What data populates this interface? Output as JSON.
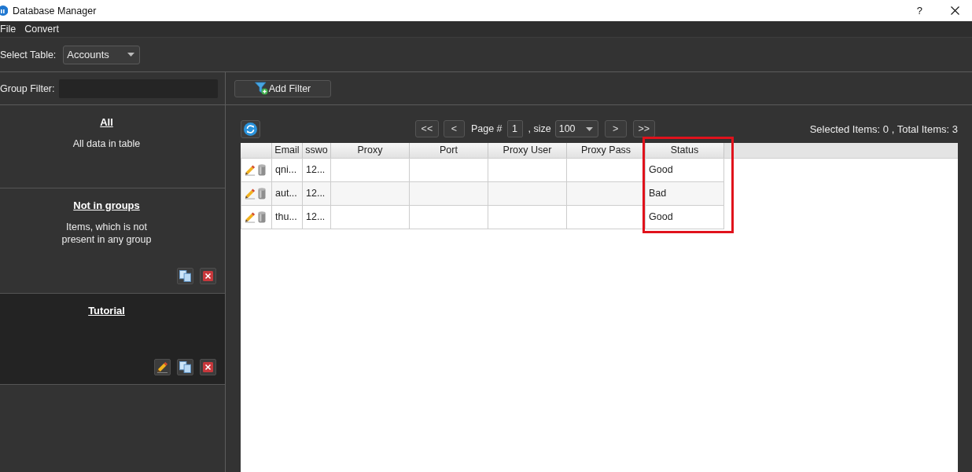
{
  "window": {
    "title": "Database Manager",
    "help": "?"
  },
  "menu": [
    {
      "label": "File"
    },
    {
      "label": "Convert"
    }
  ],
  "toolbar": {
    "label": "Select Table:",
    "table_select": {
      "value": "Accounts"
    }
  },
  "sidebar": {
    "filter": {
      "label": "Group Filter:"
    },
    "groups": [
      {
        "title": "All",
        "description": "All data in table",
        "selected": false
      },
      {
        "title": "Not in groups",
        "description": "Items, which is not present in any group",
        "selected": false,
        "actions": [
          {
            "kind": "copy"
          },
          {
            "kind": "delete"
          }
        ]
      },
      {
        "title": "Tutorial",
        "selected": true,
        "actions": [
          {
            "kind": "edit"
          },
          {
            "kind": "copy"
          },
          {
            "kind": "delete"
          }
        ]
      }
    ]
  },
  "filter_bar": {
    "add_filter": "Add Filter"
  },
  "pager": {
    "first": "<<",
    "prev": "<",
    "page_label": "Page #",
    "page": "1",
    "size_label": ", size",
    "size": "100",
    "next": ">",
    "last": ">>"
  },
  "summary": "Selected Items: 0 , Total Items: 3",
  "table": {
    "columns": [
      {
        "kind": "actions",
        "highlighted": false
      },
      {
        "kind": "text",
        "label": "Email",
        "highlighted": false
      },
      {
        "kind": "text",
        "label": "sswo",
        "highlighted": false
      },
      {
        "kind": "text",
        "label": "Proxy",
        "highlighted": false
      },
      {
        "kind": "text",
        "label": "Port",
        "highlighted": false
      },
      {
        "kind": "text",
        "label": "Proxy User",
        "highlighted": false
      },
      {
        "kind": "text",
        "label": "Proxy Pass",
        "highlighted": false
      },
      {
        "kind": "text",
        "label": "Status",
        "highlighted": true
      }
    ],
    "rows": [
      {
        "email": "qni...",
        "column_3": "12...",
        "status": "Good"
      },
      {
        "email": "aut...",
        "column_3": "12...",
        "status": "Bad"
      },
      {
        "email": "thu...",
        "column_3": "12...",
        "status": "Good"
      }
    ]
  }
}
